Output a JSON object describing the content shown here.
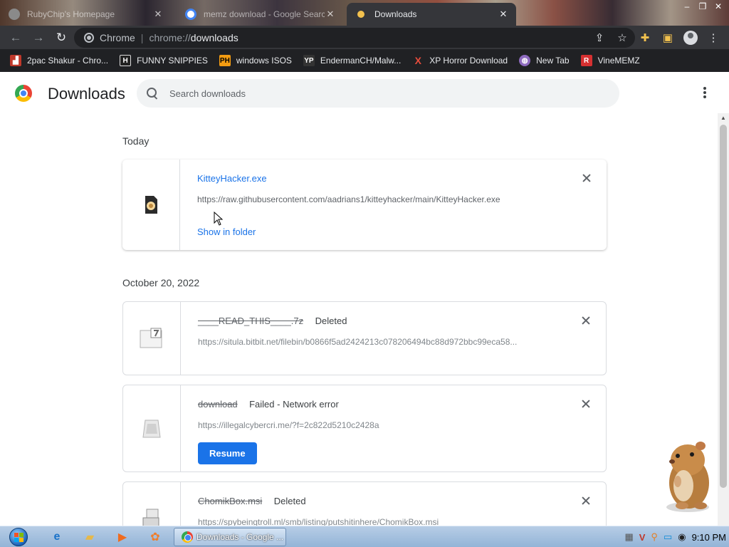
{
  "browser": {
    "tabs": [
      {
        "title": "RubyChip's Homepage",
        "active": false
      },
      {
        "title": "memz download - Google Search",
        "active": false
      },
      {
        "title": "Downloads",
        "active": true
      }
    ],
    "window_controls": [
      "–",
      "❐",
      "✕"
    ],
    "omnibox": {
      "scheme_label": "Chrome",
      "url_host": "chrome://",
      "url_path": "downloads"
    },
    "bookmarks": [
      {
        "label": "2pac Shakur - Chro...",
        "icon": "bag-icon",
        "color": "#c0392b"
      },
      {
        "label": "FUNNY SNIPPIES",
        "icon": "H",
        "color": "#222222"
      },
      {
        "label": "windows ISOS",
        "icon": "PH",
        "color": "#f39c12"
      },
      {
        "label": "EndermanCH/Malw...",
        "icon": "YP",
        "color": "#333333"
      },
      {
        "label": "XP Horror Download",
        "icon": "X",
        "color": "#e74c3c"
      },
      {
        "label": "New Tab",
        "icon": "globe-icon",
        "color": "#8e6bbf"
      },
      {
        "label": "VineMEMZ",
        "icon": "R",
        "color": "#d63031"
      }
    ]
  },
  "downloads_page": {
    "title": "Downloads",
    "search_placeholder": "Search downloads",
    "groups": [
      {
        "date": "Today",
        "items": [
          {
            "name": "KitteyHacker.exe",
            "status": "",
            "url": "https://raw.githubusercontent.com/aadrians1/kitteyhacker/main/KitteyHacker.exe",
            "action": "Show in folder"
          }
        ]
      },
      {
        "date": "October 20, 2022",
        "items": [
          {
            "name": "____READ_THIS____.7z",
            "status": "Deleted",
            "url": "https://situla.bitbit.net/filebin/b0866f5ad2424213c078206494bc88d972bbc99eca58..."
          },
          {
            "name": "download",
            "status": "Failed - Network error",
            "url": "https://illegalcybercri.me/?f=2c822d5210c2428a",
            "action": "Resume"
          },
          {
            "name": "ChomikBox.msi",
            "status": "Deleted",
            "url": "https://spybeingtroll.ml/smb/listing/putshitinhere/ChomikBox.msi"
          }
        ]
      }
    ]
  },
  "taskbar": {
    "active_task": "Downloads - Google ...",
    "clock": "9:10 PM"
  },
  "colors": {
    "accent": "#1a73e8",
    "toolbar": "#35363a",
    "bookmarks_bar": "#202124"
  }
}
